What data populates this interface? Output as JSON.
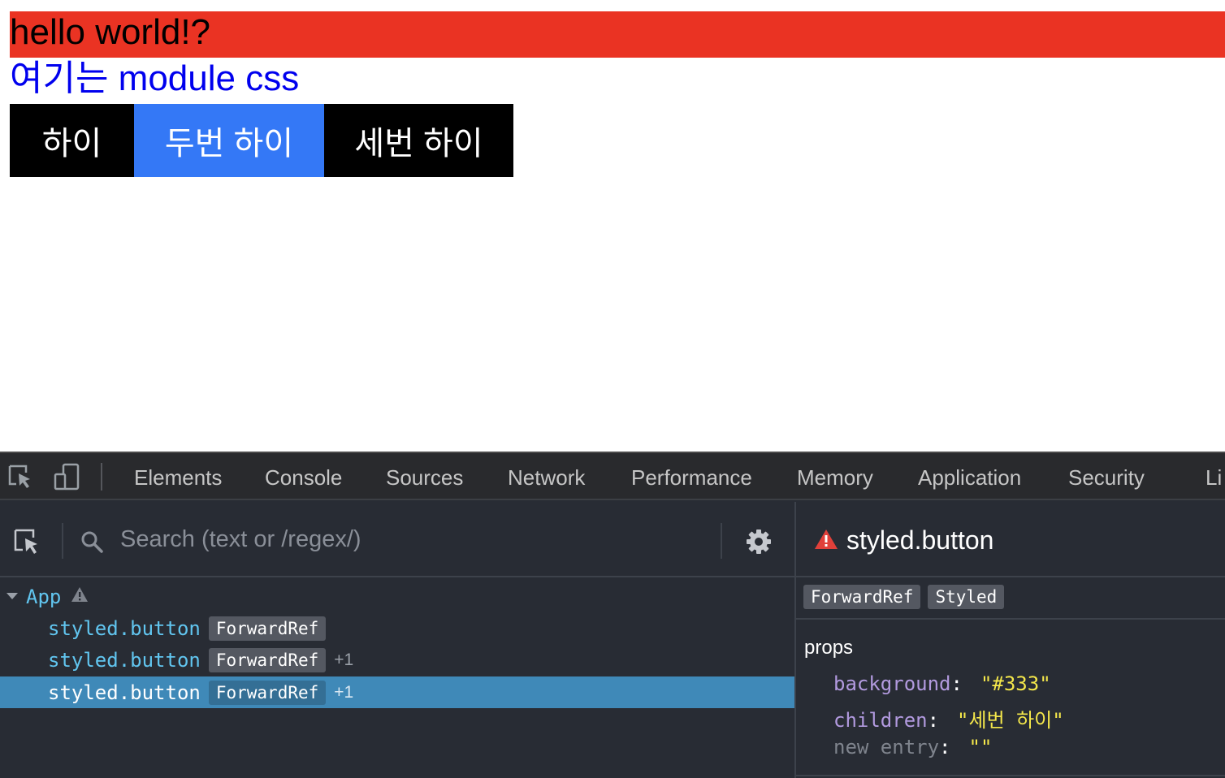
{
  "page": {
    "heading": "hello world!?",
    "module_text": "여기는 module css",
    "buttons": [
      "하이",
      "두번 하이",
      "세번 하이"
    ]
  },
  "devtools": {
    "tabs": [
      "Elements",
      "Console",
      "Sources",
      "Network",
      "Performance",
      "Memory",
      "Application",
      "Security",
      "Li"
    ],
    "search_placeholder": "Search (text or /regex/)",
    "tree": {
      "root": "App",
      "rows": [
        {
          "name": "styled.button",
          "badge": "ForwardRef",
          "extra": ""
        },
        {
          "name": "styled.button",
          "badge": "ForwardRef",
          "extra": "+1"
        },
        {
          "name": "styled.button",
          "badge": "ForwardRef",
          "extra": "+1",
          "selected": true
        }
      ]
    },
    "inspector": {
      "title": "styled.button",
      "badges": [
        "ForwardRef",
        "Styled"
      ],
      "props_label": "props",
      "props": [
        {
          "key": "background",
          "value": "\"#333\""
        },
        {
          "key": "children",
          "value": "\"세번 하이\""
        },
        {
          "key": "new entry",
          "value": "\"\""
        }
      ]
    }
  },
  "colors": {
    "heading_bg": "#ea3323",
    "module_text": "#0000ee",
    "button_dark": "#000000",
    "button_blue": "#3478f6",
    "devtools_bg": "#282c34",
    "selected_row": "#3f89b8",
    "component_name": "#61c5ef",
    "prop_key": "#b29adf",
    "prop_value": "#f5e84b",
    "warning": "#e0403a"
  }
}
